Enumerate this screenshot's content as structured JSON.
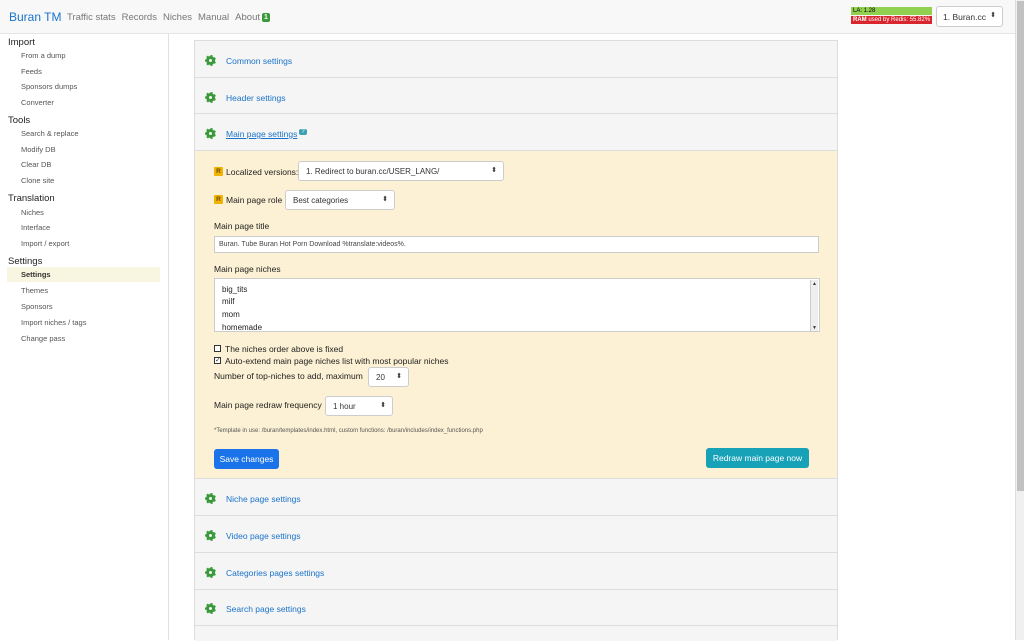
{
  "navbar": {
    "brand": "Buran TM",
    "links": [
      "Traffic stats",
      "Records",
      "Niches",
      "Manual",
      "About"
    ],
    "about_badge": "1",
    "la": "LA: 1.28",
    "ram_label": "RAM",
    "ram_text": "used by Redis: 55.82%",
    "site_select": "1. Buran.cc"
  },
  "sidebar": {
    "sections": [
      {
        "title": "Import",
        "items": [
          "From a dump",
          "Feeds",
          "Sponsors dumps",
          "Converter"
        ]
      },
      {
        "title": "Tools",
        "items": [
          "Search & replace",
          "Modify DB",
          "Clear DB",
          "Clone site"
        ]
      },
      {
        "title": "Translation",
        "items": [
          "Niches",
          "Interface",
          "Import / export"
        ]
      },
      {
        "title": "Settings",
        "items": [
          "Settings",
          "Themes",
          "Sponsors",
          "Import niches / tags",
          "Change pass"
        ]
      }
    ],
    "active": "Settings"
  },
  "accordion": {
    "common": "Common settings",
    "header": "Header settings",
    "main": "Main page settings",
    "main_help": "?",
    "niche": "Niche page settings",
    "video": "Video page settings",
    "categories": "Categories pages settings",
    "search": "Search page settings"
  },
  "main_page": {
    "r_badge": "R",
    "localized_label": "Localized versions:",
    "localized_value": "1. Redirect to buran.cc/USER_LANG/",
    "role_label": "Main page role",
    "role_value": "Best categories",
    "title_label": "Main page title",
    "title_value": "Buran. Tube Buran Hot Porn Download %translate:videos%.",
    "niches_label": "Main page niches",
    "niches": [
      "big_tits",
      "milf",
      "mom",
      "homemade"
    ],
    "fixed_label": "The niches order above is fixed",
    "fixed_checked": false,
    "autoextend_label": "Auto-extend main page niches list with most popular niches",
    "autoextend_checked": true,
    "top_label": "Number of top-niches to add, maximum",
    "top_value": "20",
    "redraw_label": "Main page redraw frequency",
    "redraw_value": "1 hour",
    "note": "*Template in use: /buran/templates/index.html, custom functions: /buran/includes/index_functions.php",
    "save_button": "Save changes",
    "redraw_button": "Redraw main page now"
  }
}
